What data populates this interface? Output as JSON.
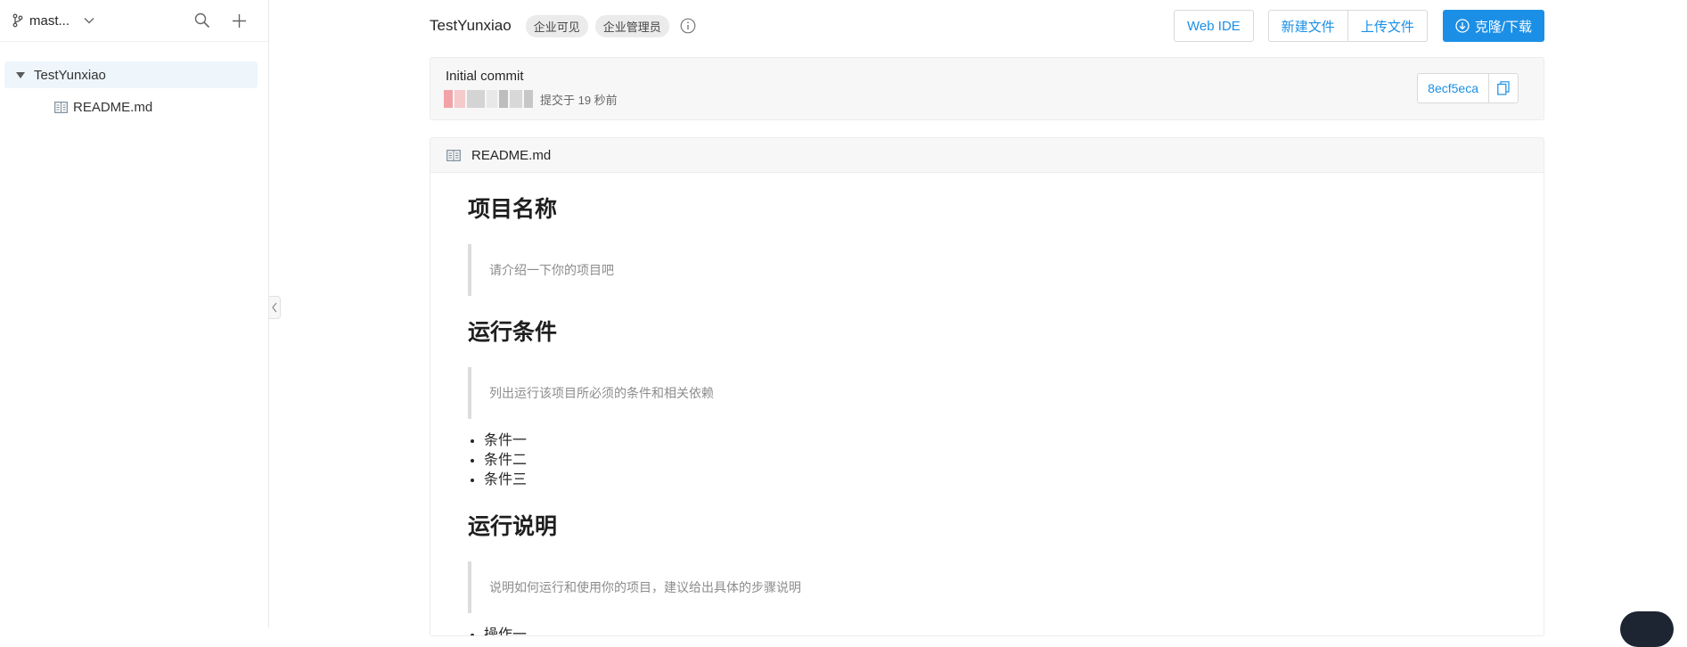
{
  "sidebar": {
    "branch": "mast...",
    "tree": {
      "root": "TestYunxiao",
      "children": [
        "README.md"
      ]
    }
  },
  "header": {
    "repo_name": "TestYunxiao",
    "tags": [
      "企业可见",
      "企业管理员"
    ],
    "web_ide": "Web IDE",
    "new_file": "新建文件",
    "upload_file": "上传文件",
    "clone_download": "克隆/下载"
  },
  "commit": {
    "message": "Initial commit",
    "time": "提交于 19 秒前",
    "sha": "8ecf5eca"
  },
  "readme": {
    "filename": "README.md",
    "sections": [
      {
        "heading": "项目名称",
        "quote": "请介绍一下你的项目吧"
      },
      {
        "heading": "运行条件",
        "quote": "列出运行该项目所必须的条件和相关依赖",
        "items": [
          "条件一",
          "条件二",
          "条件三"
        ]
      },
      {
        "heading": "运行说明",
        "quote": "说明如何运行和使用你的项目，建议给出具体的步骤说明",
        "items": [
          "操作一"
        ]
      }
    ]
  },
  "colors": {
    "accent": "#1b8fe6",
    "root_highlight": "#eef6fc",
    "panel_bg": "#f7f7f7"
  },
  "icons": {
    "branch": "git-branch-icon",
    "search": "search-icon",
    "add": "plus-icon",
    "file": "book-icon",
    "info": "info-icon",
    "download": "download-circle-icon",
    "copy": "copy-icon"
  }
}
